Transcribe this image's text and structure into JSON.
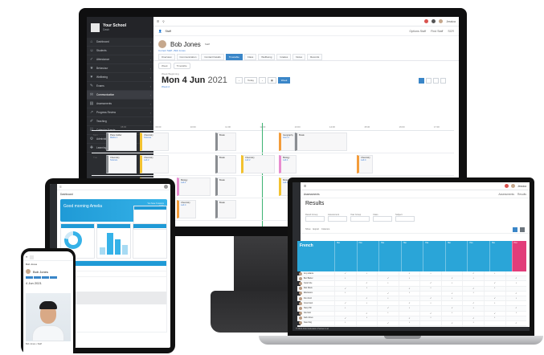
{
  "monitor": {
    "sidebar": {
      "school": "Your School",
      "school_sub": "Dash",
      "items": [
        "Dashboard",
        "Students",
        "Attendance",
        "Behaviour",
        "Wellbeing",
        "Exams",
        "Communication",
        "Assessments",
        "Progress Review",
        "Teaching",
        "Calendar Events",
        "Administration",
        "Learning Support"
      ]
    },
    "topbar": {
      "search_icon": "search-icon",
      "user": "Jessica",
      "user_sub": "Administrator"
    },
    "subbar": {
      "section": "Staff",
      "links": [
        "Options Staff",
        "Find Staff",
        "SCR"
      ]
    },
    "profile": {
      "name": "Bob Jones",
      "badge": "Staff",
      "breadcrumb": "Current Staff › Bob Jones"
    },
    "tabs": [
      "Overview",
      "Communication",
      "Contact Details",
      "Timetable",
      "Class",
      "Wellbeing",
      "Grades",
      "Notes",
      "Records"
    ],
    "active_tab": "Timetable",
    "filters": [
      "Week",
      "Timetable"
    ],
    "date": {
      "small": "Week Beginning",
      "main": "Mon 4 Jun",
      "year": "2021",
      "sub": "Week A",
      "today": "Today",
      "week": "Week"
    },
    "times": [
      "08:00",
      "09:00",
      "10:00",
      "11:00",
      "12:00",
      "13:00",
      "14:00",
      "15:00",
      "16:00",
      "17:00"
    ],
    "days": [
      "Mon",
      "Tue",
      "Wed",
      "Thu"
    ],
    "lessons": [
      {
        "title": "Place holder",
        "room": "Maths 1"
      },
      {
        "title": "Chemistry",
        "room": "Science"
      },
      {
        "title": "Chemistry",
        "room": "Lab 2"
      },
      {
        "title": "Break",
        "room": ""
      },
      {
        "title": "Geography",
        "room": "Hum 3"
      },
      {
        "title": "Chemistry",
        "room": "Science"
      },
      {
        "title": "Chemistry",
        "room": "Lab 2"
      },
      {
        "title": "Biology",
        "room": "Lab 1"
      },
      {
        "title": "Biology",
        "room": "Lab 3"
      },
      {
        "title": "Chemistry",
        "room": "Lab 4"
      }
    ]
  },
  "laptop": {
    "topbar": {
      "user": "Jessica",
      "user_sub": "Administrator"
    },
    "subbar": {
      "section": "Assessments",
      "links": [
        "Assessments",
        "Results"
      ]
    },
    "title": "Results",
    "filters": [
      "Result Group",
      "Assessment",
      "Year Group",
      "Class",
      "Subject"
    ],
    "toolbar": [
      "Show",
      "Export",
      "Columns"
    ],
    "subject": "French",
    "columns": [
      "Hist",
      "Hist",
      "Hist",
      "Hist",
      "Hist",
      "Hist",
      "Hist",
      "Hist",
      "Hist"
    ],
    "students": [
      "Amy Adams",
      "Ben Barker",
      "Cara Cole",
      "Dan Davis",
      "Ella Evans",
      "Finn Ford",
      "Gina Grant",
      "Harry Hill",
      "Isla Irwin",
      "Jack Jones",
      "Kate King",
      "Liam Lee",
      "Mia Moore",
      "Noah Nash",
      "Olivia Ott",
      "Paul Park"
    ],
    "footer": "© 2021 Arbor Education Partners Ltd"
  },
  "tablet": {
    "section": "Dashboard",
    "greeting": "Good morning Amelia",
    "greeting_sub": "You have 3 lessons today"
  },
  "phone": {
    "section": "Bob Jones",
    "name": "Bob Jones",
    "date": "4 Jun 2021",
    "foot": "Bob Jones • Staff"
  }
}
